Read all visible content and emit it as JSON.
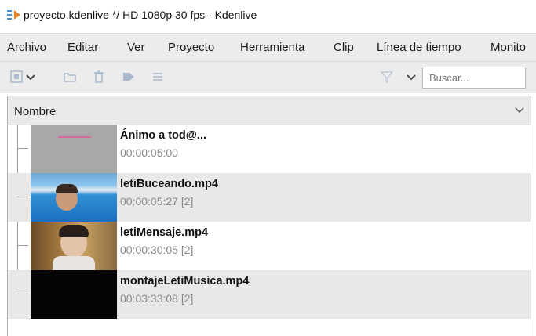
{
  "window": {
    "title": "proyecto.kdenlive */ HD 1080p 30 fps - Kdenlive",
    "app_icon": "kdenlive-icon"
  },
  "menubar": {
    "items": [
      "Archivo",
      "Editar",
      "Ver",
      "Proyecto",
      "Herramienta",
      "Clip",
      "Línea de tiempo",
      "Monito"
    ]
  },
  "toolbar": {
    "icons": [
      "add-clip-icon",
      "dropdown-arrow-icon",
      "folder-icon",
      "trash-icon",
      "tag-icon",
      "menu-icon",
      "filter-icon",
      "dropdown-arrow-icon"
    ],
    "search": {
      "placeholder": "Buscar...",
      "value": ""
    }
  },
  "bin": {
    "column_header": "Nombre",
    "clips": [
      {
        "name": "Ánimo a tod@...",
        "meta": "00:00:05:00"
      },
      {
        "name": "letiBuceando.mp4",
        "meta": "00:00:05:27 [2]"
      },
      {
        "name": "letiMensaje.mp4",
        "meta": "00:00:30:05 [2]"
      },
      {
        "name": "montajeLetiMusica.mp4",
        "meta": "00:03:33:08 [2]"
      }
    ]
  },
  "colors": {
    "menubar_bg": "#ececec",
    "alt_row_bg": "#e9e8e6",
    "meta_text": "#8a8a8a",
    "icon_disabled": "#a9b9cc"
  }
}
